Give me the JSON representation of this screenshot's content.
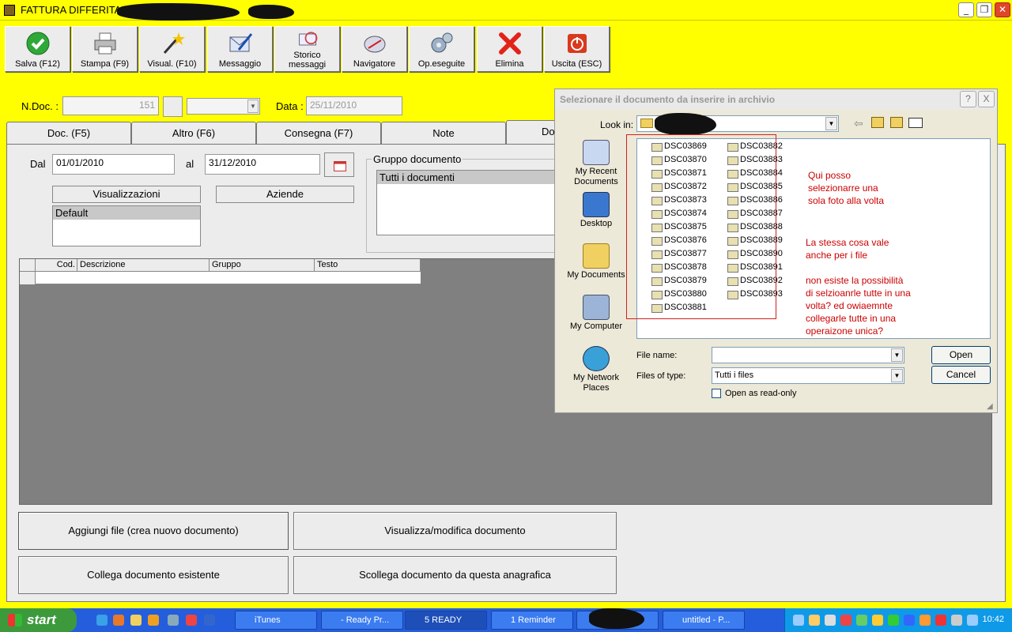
{
  "window": {
    "title": "FATTURA DIFFERITA N."
  },
  "toolbar": [
    {
      "label": "Salva (F12)",
      "icon": "check-icon"
    },
    {
      "label": "Stampa (F9)",
      "icon": "printer-icon"
    },
    {
      "label": "Visual. (F10)",
      "icon": "magic-wand-icon"
    },
    {
      "label": "Messaggio",
      "icon": "envelope-pen-icon"
    },
    {
      "label": "Storico messaggi",
      "icon": "message-history-icon"
    },
    {
      "label": "Navigatore",
      "icon": "navigator-icon"
    },
    {
      "label": "Op.eseguite",
      "icon": "gears-icon"
    },
    {
      "label": "Elimina",
      "icon": "red-x-icon"
    },
    {
      "label": "Uscita (ESC)",
      "icon": "power-icon"
    }
  ],
  "form": {
    "ndoc_label": "N.Doc. :",
    "ndoc_value": "151",
    "data_label": "Data :",
    "data_value": "25/11/2010"
  },
  "tabs": [
    {
      "label": "Doc. (F5)"
    },
    {
      "label": "Altro (F6)"
    },
    {
      "label": "Consegna (F7)"
    },
    {
      "label": "Note"
    },
    {
      "label": "Do"
    }
  ],
  "filters": {
    "dal_label": "Dal",
    "dal_value": "01/01/2010",
    "al_label": "al",
    "al_value": "31/12/2010",
    "visualizzazioni": "Visualizzazioni",
    "aziende": "Aziende",
    "default_item": "Default",
    "gruppo_label": "Gruppo documento",
    "gruppo_item": "Tutti i documenti"
  },
  "grid": {
    "columns": [
      "Cod.",
      "Descrizione",
      "Gruppo",
      "Testo"
    ]
  },
  "actions": {
    "aggiungi": "Aggiungi file (crea nuovo documento)",
    "visualizza": "Visualizza/modifica documento",
    "collega": "Collega documento esistente",
    "scollega": "Scollega documento da questa anagrafica"
  },
  "dialog": {
    "title": "Selezionare il documento da inserire in archivio",
    "look_in_label": "Look in:",
    "places": [
      "My Recent Documents",
      "Desktop",
      "My Documents",
      "My Computer",
      "My Network Places"
    ],
    "files_col1": [
      "DSC03869",
      "DSC03870",
      "DSC03871",
      "DSC03872",
      "DSC03873",
      "DSC03874",
      "DSC03875",
      "DSC03876",
      "DSC03877",
      "DSC03878",
      "DSC03879",
      "DSC03880",
      "DSC03881"
    ],
    "files_col2": [
      "DSC03882",
      "DSC03883",
      "DSC03884",
      "DSC03885",
      "DSC03886",
      "DSC03887",
      "DSC03888",
      "DSC03889",
      "DSC03890",
      "DSC03891",
      "DSC03892",
      "DSC03893"
    ],
    "note1": [
      "Qui posso",
      "selezionarre una",
      "sola foto alla volta"
    ],
    "note2": [
      "La stessa cosa vale",
      "anche per i file"
    ],
    "note3": [
      "non esiste la possibilità",
      "di selzioanrle tutte in una",
      "volta? ed owiaemnte",
      "collegarle tutte in una",
      "operaizone unica?"
    ],
    "file_name_label": "File name:",
    "file_name_value": "",
    "files_of_type_label": "Files of type:",
    "files_of_type_value": "Tutti i files",
    "read_only_label": "Open as read-only",
    "open_button": "Open",
    "cancel_button": "Cancel",
    "help": "?",
    "close": "X"
  },
  "taskbar": {
    "start": "start",
    "tasks": [
      "iTunes",
      "- Ready Pr...",
      "5 READY",
      "1 Reminder",
      "",
      "untitled - P..."
    ],
    "clock": "10:42"
  }
}
